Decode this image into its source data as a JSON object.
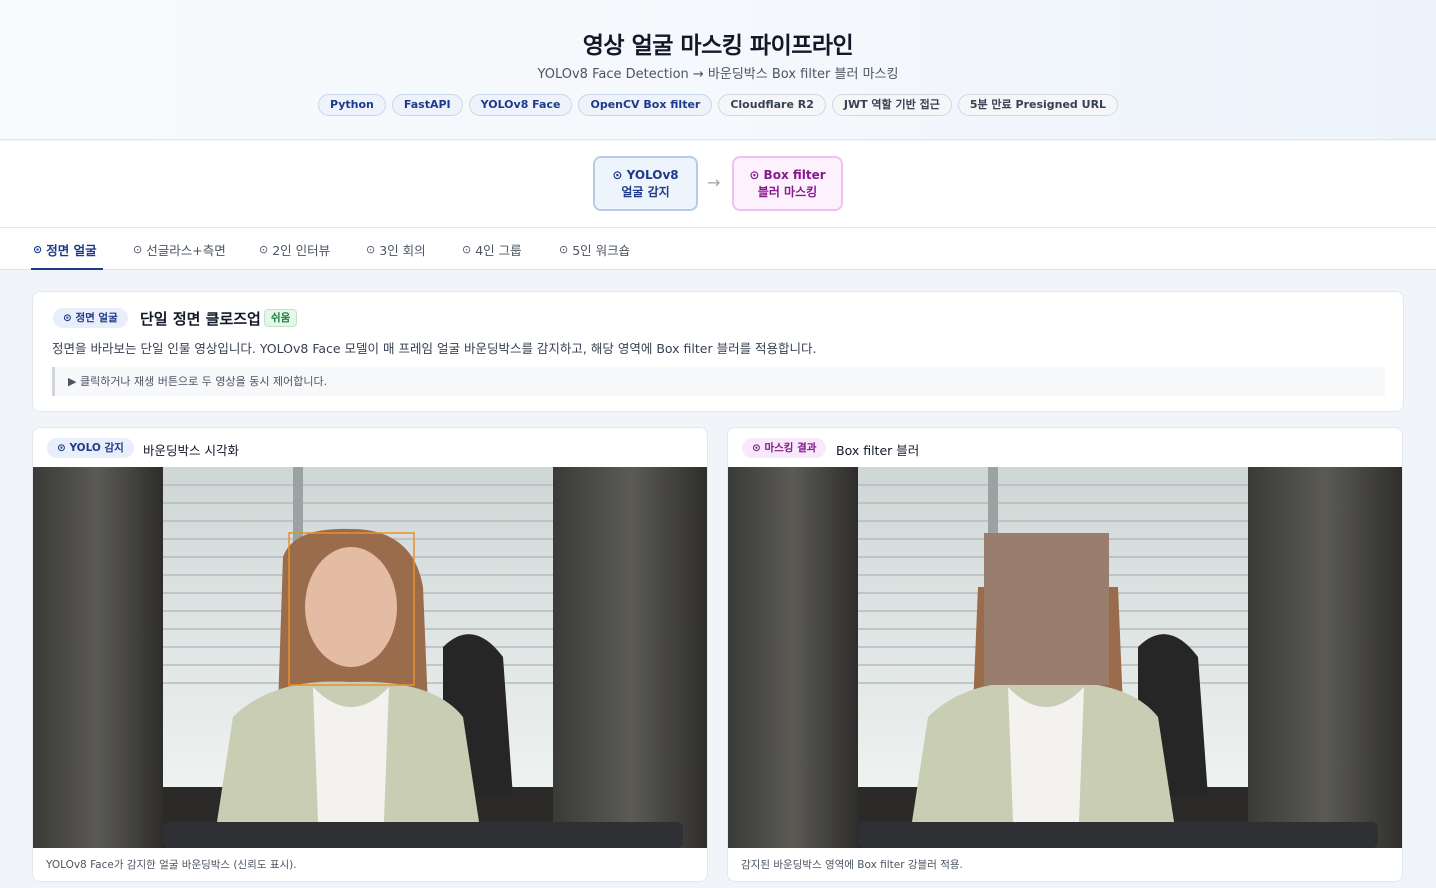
{
  "header": {
    "title": "영상 얼굴 마스킹 파이프라인",
    "subtitle": "YOLOv8 Face Detection → 바운딩박스 Box filter 블러 마스킹",
    "chips": [
      "Python",
      "FastAPI",
      "YOLOv8 Face",
      "OpenCV Box filter",
      "Cloudflare R2",
      "JWT 역할 기반 접근",
      "5분 만료 Presigned URL"
    ]
  },
  "pipeline": {
    "stage1_line1": "⊙ YOLOv8",
    "stage1_line2": "얼굴 감지",
    "arrow": "→",
    "stage2_line1": "⊙ Box filter",
    "stage2_line2": "블러 마스킹"
  },
  "tabs": [
    {
      "label": "정면 얼굴",
      "icon": "target-icon"
    },
    {
      "label": "선글라스+측면",
      "icon": "target-icon"
    },
    {
      "label": "2인 인터뷰",
      "icon": "target-icon"
    },
    {
      "label": "3인 회의",
      "icon": "target-icon"
    },
    {
      "label": "4인 그룹",
      "icon": "target-icon"
    },
    {
      "label": "5인 워크숍",
      "icon": "target-icon"
    }
  ],
  "tab_icon_glyph": "⊙",
  "scene": {
    "badge": "⊙ 정면 얼굴",
    "title": "단일 정면 클로즈업",
    "difficulty": "쉬움",
    "description": "정면을 바라보는 단일 인물 영상입니다. YOLOv8 Face 모델이 매 프레임 얼굴 바운딩박스를 감지하고, 해당 영역에 Box filter 블러를 적용합니다.",
    "hint": "▶ 클릭하거나 재생 버튼으로 두 영상을 동시 제어합니다."
  },
  "panels": {
    "left": {
      "badge": "⊙ YOLO 감지",
      "title": "바운딩박스 시각화",
      "caption": "YOLOv8 Face가 감지한 얼굴 바운딩박스 (신뢰도 표시)."
    },
    "right": {
      "badge": "⊙ 마스킹 결과",
      "title": "Box filter 블러",
      "caption": "감지된 바운딩박스 영역에 Box filter 강블러 적용."
    }
  },
  "colors": {
    "accent_blue": "#1e3a8a",
    "accent_pink": "#86198f",
    "bbox_orange": "#e8902c",
    "blur_brown": "#9a7e6d"
  }
}
